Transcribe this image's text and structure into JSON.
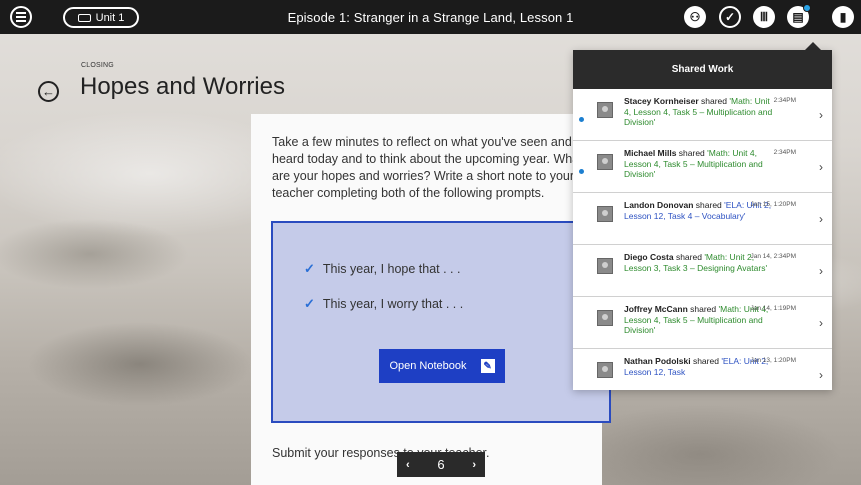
{
  "topbar": {
    "unit_label": "Unit 1",
    "title": "Episode 1: Stranger in a Strange Land, Lesson 1",
    "icons": [
      "menu-icon",
      "keyboard-icon",
      "people-icon",
      "checkmark-icon",
      "library-icon",
      "shared-work-icon",
      "clipboard-icon"
    ]
  },
  "header": {
    "section": "CLOSING",
    "title": "Hopes and Worries"
  },
  "card": {
    "intro": "Take a few minutes to reflect on what you've seen and heard today and to think about the upcoming year. What are your hopes and worries? Write a short note to your teacher completing both of the following prompts.",
    "prompts": [
      "This year, I hope that . . .",
      "This year, I worry that . . ."
    ],
    "open_notebook": "Open Notebook",
    "submit": "Submit your responses to your teacher."
  },
  "pager": {
    "page": "6"
  },
  "shared_work": {
    "title": "Shared Work",
    "items": [
      {
        "name": "Stacey Kornheiser",
        "verb": "shared",
        "task": "'Math: Unit 4, Lesson 4, Task 5 – Multiplication and Division'",
        "time": "2:34PM",
        "unread": true,
        "color": "green"
      },
      {
        "name": "Michael Mills",
        "verb": "shared",
        "task": "'Math: Unit 4, Lesson 4, Task 5 – Multiplication and Division'",
        "time": "2:34PM",
        "unread": true,
        "color": "green"
      },
      {
        "name": "Landon Donovan",
        "verb": "shared",
        "task": "'ELA: Unit 2, Lesson 12, Task 4 – Vocabulary'",
        "time": "Jan 15, 1:20PM",
        "unread": false,
        "color": "blue"
      },
      {
        "name": "Diego Costa",
        "verb": "shared",
        "task": "'Math: Unit 2, Lesson 3, Task 3 – Designing Avatars'",
        "time": "Jan 14, 2:34PM",
        "unread": false,
        "color": "green"
      },
      {
        "name": "Joffrey McCann",
        "verb": "shared",
        "task": "'Math: Unit 4, Lesson 4, Task 5 – Multiplication and Division'",
        "time": "Jan 14, 1:19PM",
        "unread": false,
        "color": "green"
      },
      {
        "name": "Nathan Podolski",
        "verb": "shared",
        "task": "'ELA: Unit 2, Lesson 12, Task",
        "time": "Jan 13, 1:20PM",
        "unread": false,
        "color": "blue"
      }
    ]
  }
}
